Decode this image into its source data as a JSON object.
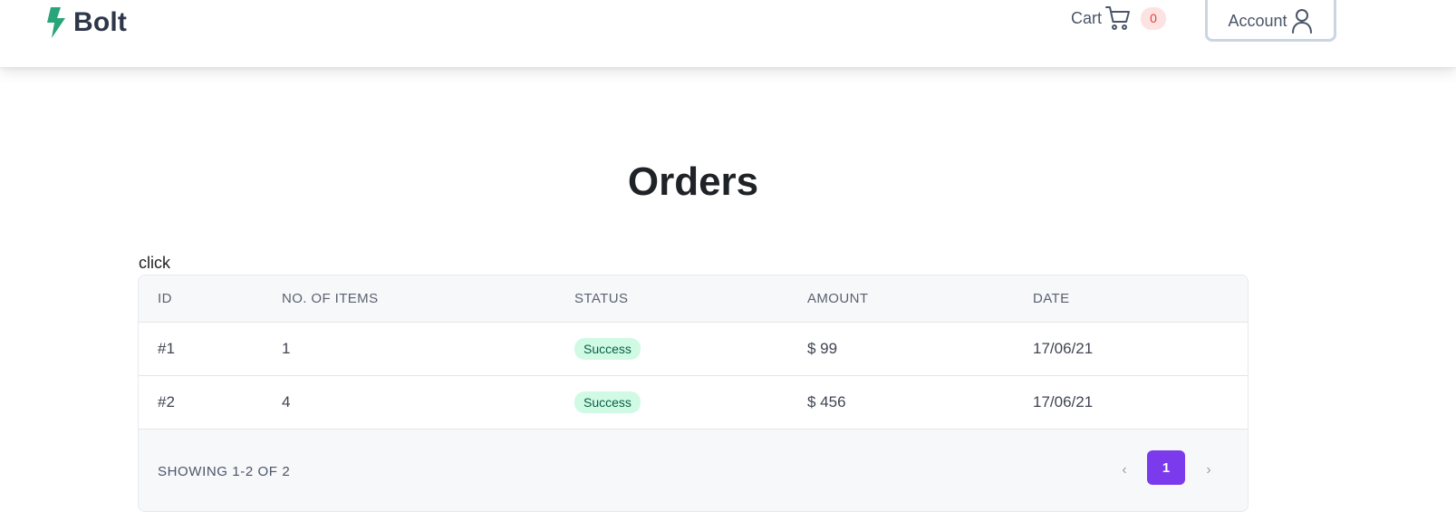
{
  "brand": {
    "name": "Bolt",
    "icon": "bolt-icon",
    "color": "#2aa57a"
  },
  "nav": {
    "cart_label": "Cart",
    "cart_icon": "shopping-cart-icon",
    "cart_count": "0",
    "account_label": "Account",
    "account_icon": "user-icon"
  },
  "page": {
    "title": "Orders",
    "click_text": "click"
  },
  "table": {
    "headers": [
      "ID",
      "NO. OF ITEMS",
      "STATUS",
      "AMOUNT",
      "DATE"
    ],
    "rows": [
      {
        "id": "#1",
        "items": "1",
        "status": "Success",
        "amount": "$ 99",
        "date": "17/06/21"
      },
      {
        "id": "#2",
        "items": "4",
        "status": "Success",
        "amount": "$ 456",
        "date": "17/06/21"
      }
    ],
    "status_color": "#d1fae5"
  },
  "pagination": {
    "showing": "SHOWING 1-2 OF 2",
    "prev": "‹",
    "next": "›",
    "current_page": "1",
    "accent": "#7c3aed"
  }
}
